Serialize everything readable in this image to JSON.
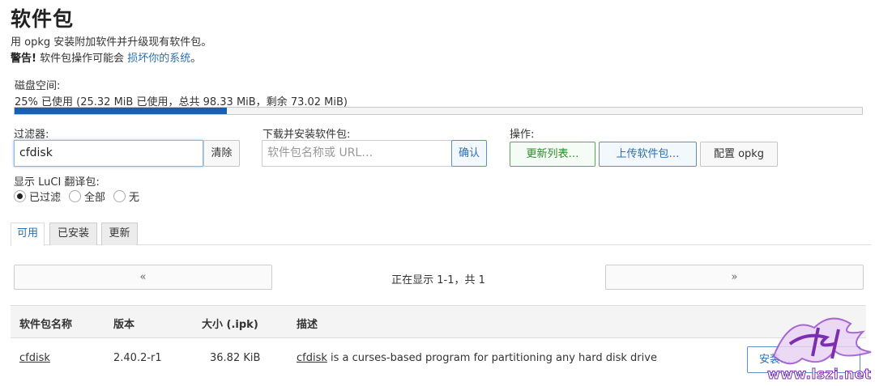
{
  "page": {
    "title": "软件包",
    "description": "用 opkg 安装附加软件并升级现有软件包。",
    "warning_prefix": "警告!",
    "warning_text": " 软件包操作可能会 ",
    "warning_link": "损坏你的系统",
    "warning_suffix": "。"
  },
  "disk": {
    "label": "磁盘空间:",
    "usage_text": "25% 已使用 (25.32 MiB 已使用，总共 98.33 MiB，剩余 73.02 MiB)",
    "used_fraction": 0.25
  },
  "filter": {
    "label": "过滤器:",
    "value": "cfdisk",
    "clear_label": "清除"
  },
  "download": {
    "label": "下载并安装软件包:",
    "placeholder": "软件包名称或 URL…",
    "confirm_label": "确认"
  },
  "actions": {
    "label": "操作:",
    "update_lists": "更新列表…",
    "upload_package": "上传软件包…",
    "configure_opkg": "配置 opkg"
  },
  "translations": {
    "label": "显示 LuCI 翻译包:",
    "options": [
      "已过滤",
      "全部",
      "无"
    ],
    "selected": "已过滤"
  },
  "tabs": [
    "可用",
    "已安装",
    "更新"
  ],
  "pager": {
    "prev": "«",
    "next": "»",
    "status": "正在显示 1-1，共 1"
  },
  "table": {
    "headers": [
      "软件包名称",
      "版本",
      "大小 (.ipk)",
      "描述"
    ],
    "rows": [
      {
        "name": "cfdisk",
        "version": "2.40.2-r1",
        "size": "36.82 KiB",
        "desc_name": "cfdisk",
        "desc_rest": " is a curses-based program for partitioning any hard disk drive",
        "action": "安装…"
      }
    ]
  },
  "watermark": {
    "text": "www.lszi.net",
    "colors": {
      "purple": "#7b2fb0",
      "pink": "#e060c0"
    }
  },
  "colors": {
    "link": "#2a6fb5",
    "progress": "#1a5fb4",
    "green": "#2d8a2d"
  }
}
